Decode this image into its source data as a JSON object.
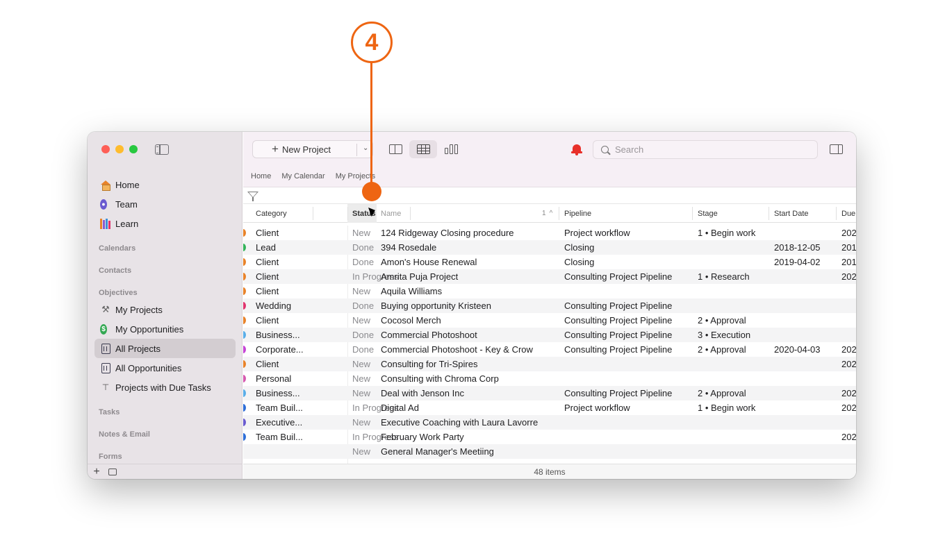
{
  "callout": {
    "number": "4"
  },
  "sidebar": {
    "top_items": [
      {
        "label": "Home",
        "icon": "home-icon"
      },
      {
        "label": "Team",
        "icon": "team-icon"
      },
      {
        "label": "Learn",
        "icon": "books-icon"
      }
    ],
    "sections": [
      "Calendars",
      "Contacts",
      "Objectives"
    ],
    "objective_items": [
      {
        "label": "My Projects",
        "icon": "hammer-icon"
      },
      {
        "label": "My Opportunities",
        "icon": "dollar-icon"
      },
      {
        "label": "All Projects",
        "icon": "document-icon",
        "selected": true
      },
      {
        "label": "All Opportunities",
        "icon": "dollar-document-icon"
      },
      {
        "label": "Projects with Due Tasks",
        "icon": "due-tasks-icon"
      }
    ],
    "bottom_sections": [
      "Tasks",
      "Notes & Email",
      "Forms"
    ],
    "add_label": "+"
  },
  "toolbar": {
    "new_project_label": "New Project",
    "search_placeholder": "Search"
  },
  "breadcrumb": [
    "Home",
    "My Calendar",
    "My Projects"
  ],
  "table": {
    "columns": [
      "Category",
      "Status",
      "Name",
      "Pipeline",
      "Stage",
      "Start Date",
      "Due"
    ],
    "sort_indicator": "1",
    "rows": [
      {
        "category": "Client",
        "status": "New",
        "name": "124 Ridgeway Closing procedure",
        "pipeline": "Project workflow",
        "stage": "1 • Begin work",
        "start": "",
        "due": "202",
        "dot": "#e8832a"
      },
      {
        "category": "Lead",
        "status": "Done",
        "name": "394 Rosedale",
        "pipeline": "Closing",
        "stage": "",
        "start": "2018-12-05",
        "due": "201",
        "dot": "#34b35a"
      },
      {
        "category": "Client",
        "status": "Done",
        "name": "Amon's House Renewal",
        "pipeline": "Closing",
        "stage": "",
        "start": "2019-04-02",
        "due": "201",
        "dot": "#e8832a"
      },
      {
        "category": "Client",
        "status": "In Progress",
        "name": "Amrita Puja Project",
        "pipeline": "Consulting Project Pipeline",
        "stage": "1 • Research",
        "start": "",
        "due": "202",
        "dot": "#e8832a"
      },
      {
        "category": "Client",
        "status": "New",
        "name": "Aquila Williams",
        "pipeline": "",
        "stage": "",
        "start": "",
        "due": "",
        "dot": "#e8832a"
      },
      {
        "category": "Wedding",
        "status": "Done",
        "name": "Buying opportunity Kristeen",
        "pipeline": "Consulting Project Pipeline",
        "stage": "",
        "start": "",
        "due": "",
        "dot": "#e0356e"
      },
      {
        "category": "Client",
        "status": "New",
        "name": "Cocosol Merch",
        "pipeline": "Consulting Project Pipeline",
        "stage": "2 • Approval",
        "start": "",
        "due": "",
        "dot": "#e8832a"
      },
      {
        "category": "Business...",
        "status": "Done",
        "name": "Commercial Photoshoot",
        "pipeline": "Consulting Project Pipeline",
        "stage": "3 • Execution",
        "start": "",
        "due": "",
        "dot": "#5aaee8"
      },
      {
        "category": "Corporate...",
        "status": "Done",
        "name": "Commercial Photoshoot - Key & Crow",
        "pipeline": "Consulting Project Pipeline",
        "stage": "2 • Approval",
        "start": "2020-04-03",
        "due": "202",
        "dot": "#c644d6"
      },
      {
        "category": "Client",
        "status": "New",
        "name": "Consulting for Tri-Spires",
        "pipeline": "",
        "stage": "",
        "start": "",
        "due": "202",
        "dot": "#e8832a"
      },
      {
        "category": "Personal",
        "status": "New",
        "name": "Consulting with Chroma Corp",
        "pipeline": "",
        "stage": "",
        "start": "",
        "due": "",
        "dot": "#d65ab0"
      },
      {
        "category": "Business...",
        "status": "New",
        "name": "Deal with Jenson Inc",
        "pipeline": "Consulting Project Pipeline",
        "stage": "2 • Approval",
        "start": "",
        "due": "202",
        "dot": "#5aaee8"
      },
      {
        "category": "Team Buil...",
        "status": "In Progress",
        "name": "Digital Ad",
        "pipeline": "Project workflow",
        "stage": "1 • Begin work",
        "start": "",
        "due": "202",
        "dot": "#2f6fd8"
      },
      {
        "category": "Executive...",
        "status": "New",
        "name": "Executive Coaching with Laura Lavorre",
        "pipeline": "",
        "stage": "",
        "start": "",
        "due": "",
        "dot": "#6a5bd0"
      },
      {
        "category": "Team Buil...",
        "status": "In Progress",
        "name": "February Work Party",
        "pipeline": "",
        "stage": "",
        "start": "",
        "due": "202",
        "dot": "#2f6fd8"
      },
      {
        "category": "",
        "status": "New",
        "name": "General Manager's Meetiing",
        "pipeline": "",
        "stage": "",
        "start": "",
        "due": "",
        "dot": ""
      }
    ]
  },
  "status_bar": {
    "count": "48 items"
  }
}
